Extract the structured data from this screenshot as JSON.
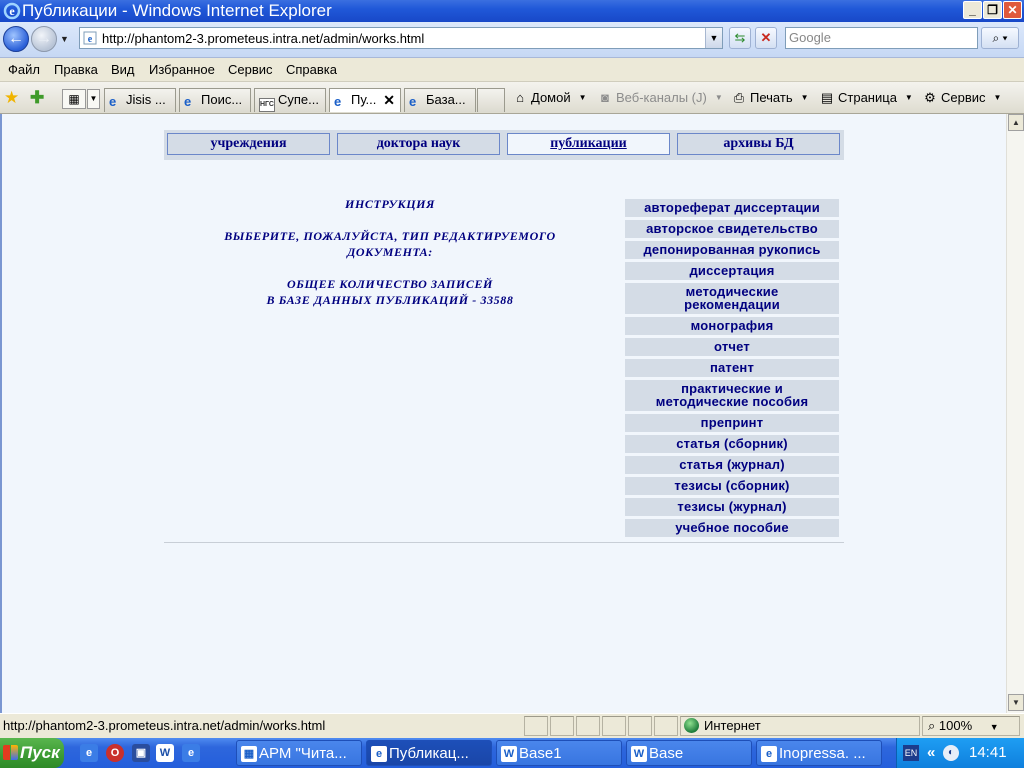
{
  "window": {
    "title": "Публикации - Windows Internet Explorer",
    "minimize_icon": "minimize-icon",
    "restore_icon": "restore-icon",
    "close_icon": "close-icon"
  },
  "address_bar": {
    "url": "http://phantom2-3.prometeus.intra.net/admin/works.html",
    "search_placeholder": "Google"
  },
  "menu": {
    "items": [
      "Файл",
      "Правка",
      "Вид",
      "Избранное",
      "Сервис",
      "Справка"
    ]
  },
  "tabs": [
    {
      "label": "Jisis ...",
      "icon": "ie-page-icon"
    },
    {
      "label": "Поис...",
      "icon": "ie-page-icon"
    },
    {
      "label": "Супе...",
      "icon": "ngs-icon",
      "icon_text": "НГС"
    },
    {
      "label": "Пу...",
      "icon": "ie-page-icon",
      "active": true
    },
    {
      "label": "База...",
      "icon": "ie-page-icon"
    }
  ],
  "command_bar": {
    "home": "Домой",
    "feeds": "Веб-каналы (J)",
    "print": "Печать",
    "page": "Страница",
    "tools": "Сервис"
  },
  "page": {
    "nav": [
      {
        "label": "учреждения"
      },
      {
        "label": "доктора наук"
      },
      {
        "label": "публикации",
        "active": true
      },
      {
        "label": "архивы БД"
      }
    ],
    "instruction": {
      "heading": "ИНСТРУКЦИЯ",
      "line1": "ВЫБЕРИТЕ, ПОЖАЛУЙСТА, ТИП РЕДАКТИРУЕМОГО",
      "line2": "ДОКУМЕНТА:",
      "line3": "ОБЩЕЕ КОЛИЧЕСТВО ЗАПИСЕЙ",
      "line4": "В БАЗЕ ДАННЫХ ПУБЛИКАЦИЙ - 33588"
    },
    "doc_types": [
      "автореферат диссертации",
      "авторское свидетельство",
      "депонированная рукопись",
      "диссертация",
      "методические\nрекомендации",
      "монография",
      "отчет",
      "патент",
      "практические и\nметодические пособия",
      "препринт",
      "статья (сборник)",
      "статья (журнал)",
      "тезисы (сборник)",
      "тезисы (журнал)",
      "учебное пособие"
    ]
  },
  "status_bar": {
    "text": "http://phantom2-3.prometeus.intra.net/admin/works.html",
    "zone": "Интернет",
    "zoom": "100%"
  },
  "taskbar": {
    "start": "Пуск",
    "buttons": [
      {
        "label": "АРМ \"Чита...",
        "icon": "app-icon"
      },
      {
        "label": "Публикац...",
        "icon": "ie-page-icon",
        "active": true
      },
      {
        "label": "Base1",
        "icon": "word-icon"
      },
      {
        "label": "Base",
        "icon": "word-icon"
      },
      {
        "label": "Inopressa. ...",
        "icon": "ie-page-icon"
      }
    ],
    "lang": "EN",
    "clock": "14:41"
  },
  "colors": {
    "nav_text": "#000080",
    "page_bg": "#f1f6fc",
    "nav_bg": "#d4dce6"
  }
}
